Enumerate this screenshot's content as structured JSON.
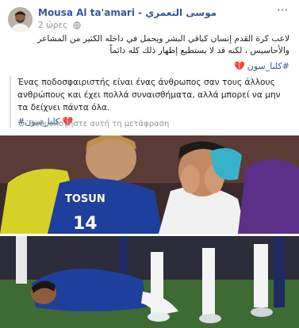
{
  "post": {
    "author_name": "Mousa Al ta'amari - موسى التعمري",
    "timestamp": "2 ώρες",
    "privacy_icon": "globe-icon",
    "more_icon": "more-options-icon",
    "text_arabic": "لاعب كرة القدم إنسان كباقي البشر ويحمل في داخله الكثير من المشاعر والأحاسيس ، لكنه قد لا يستطيع إظهار ذلك كله دائماً",
    "hashtag": "#كلنا_سون",
    "heart_glyph": "💔",
    "translation": {
      "text": "Ένας ποδοσφαιριστής είναι ένας άνθρωπος σαν τους άλλους ανθρώπους και έχει πολλά συναισθήματα, αλλά μπορεί να μην τα δείχνει πάντα όλα.",
      "hashtag": "#كلنا_سون",
      "heart_glyph": "💔"
    },
    "rate_translation_label": "Βαθμολογήστε αυτή τη μετάφραση",
    "rate_icon": "gear-icon",
    "jersey_text": "TOSUN",
    "jersey_number": "14",
    "colors": {
      "link": "#365899",
      "meta": "#90949c",
      "everton_blue": "#1f3f9c",
      "grass": "#3d6b33"
    }
  }
}
